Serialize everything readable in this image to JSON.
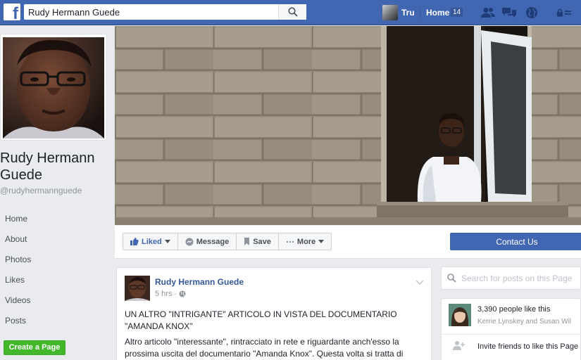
{
  "topbar": {
    "logo": "f",
    "search_value": "Rudy Hermann Guede",
    "user_name": "Tru",
    "home_label": "Home",
    "home_count": "14"
  },
  "sidebar": {
    "page_name": "Rudy Hermann Guede",
    "handle": "@rudyhermannguede",
    "nav": [
      "Home",
      "About",
      "Photos",
      "Likes",
      "Videos",
      "Posts"
    ],
    "create_page": "Create a Page"
  },
  "actions": {
    "liked": "Liked",
    "message": "Message",
    "save": "Save",
    "more": "More",
    "contact": "Contact Us"
  },
  "post": {
    "author": "Rudy Hermann Guede",
    "time": "5 hrs",
    "title": "UN ALTRO \"INTRIGANTE\" ARTICOLO IN VISTA DEL DOCUMENTARIO \"AMANDA KNOX\"",
    "body": "Altro articolo \"interessante\", rintracciato in rete e riguardante anch'esso la prossima uscita del documentario \"Amanda Knox\". Questa volta si tratta di"
  },
  "right": {
    "search_placeholder": "Search for posts on this Page",
    "likes_count": "3,390 people like this",
    "likes_friends": "Kerrie Lynskey and Susan Wil",
    "invite_text": "Invite friends to like this Page"
  },
  "colors": {
    "brand": "#4267b2",
    "link": "#365899",
    "create_green": "#42b72a"
  }
}
